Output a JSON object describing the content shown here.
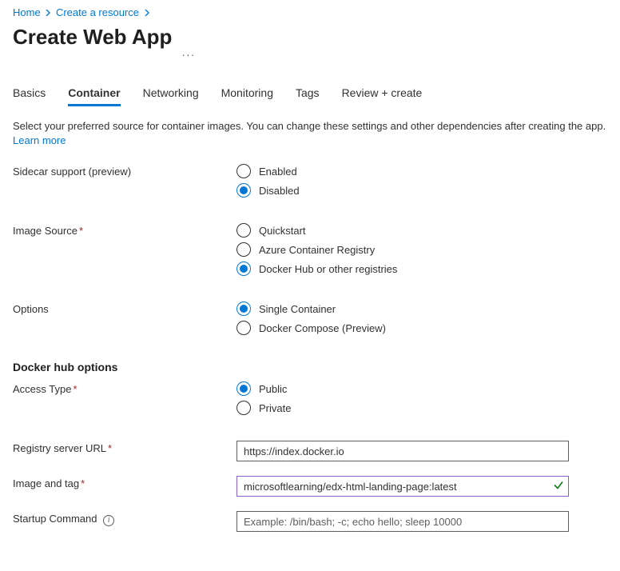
{
  "breadcrumb": {
    "items": [
      "Home",
      "Create a resource"
    ]
  },
  "page": {
    "title": "Create Web App"
  },
  "tabs": [
    {
      "label": "Basics",
      "active": false
    },
    {
      "label": "Container",
      "active": true
    },
    {
      "label": "Networking",
      "active": false
    },
    {
      "label": "Monitoring",
      "active": false
    },
    {
      "label": "Tags",
      "active": false
    },
    {
      "label": "Review + create",
      "active": false
    }
  ],
  "intro": {
    "text": "Select your preferred source for container images. You can change these settings and other dependencies after creating the app. ",
    "learn_more": "Learn more"
  },
  "sidecar": {
    "label": "Sidecar support (preview)",
    "options": [
      {
        "label": "Enabled",
        "checked": false
      },
      {
        "label": "Disabled",
        "checked": true
      }
    ]
  },
  "image_source": {
    "label": "Image Source",
    "options": [
      {
        "label": "Quickstart",
        "checked": false
      },
      {
        "label": "Azure Container Registry",
        "checked": false
      },
      {
        "label": "Docker Hub or other registries",
        "checked": true
      }
    ]
  },
  "options_group": {
    "label": "Options",
    "options": [
      {
        "label": "Single Container",
        "checked": true
      },
      {
        "label": "Docker Compose (Preview)",
        "checked": false
      }
    ]
  },
  "docker_hub": {
    "heading": "Docker hub options",
    "access_type": {
      "label": "Access Type",
      "options": [
        {
          "label": "Public",
          "checked": true
        },
        {
          "label": "Private",
          "checked": false
        }
      ]
    },
    "registry_url": {
      "label": "Registry server URL",
      "value": "https://index.docker.io"
    },
    "image_tag": {
      "label": "Image and tag",
      "value": "microsoftlearning/edx-html-landing-page:latest"
    },
    "startup": {
      "label": "Startup Command",
      "value": "",
      "placeholder": "Example: /bin/bash; -c; echo hello; sleep 10000"
    }
  }
}
